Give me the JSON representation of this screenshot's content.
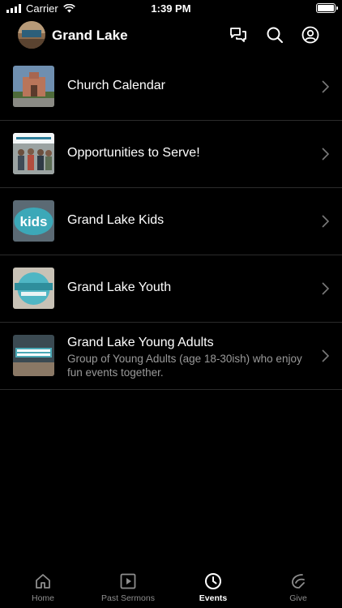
{
  "status_bar": {
    "carrier": "Carrier",
    "time": "1:39 PM"
  },
  "header": {
    "title": "Grand Lake",
    "avatar_logo_text": "GRAND LAKE",
    "icons": [
      "chat-icon",
      "search-icon",
      "account-icon"
    ]
  },
  "items": [
    {
      "title": "Church Calendar",
      "description": ""
    },
    {
      "title": "Opportunities to Serve!",
      "description": "",
      "thumb_text": "OPPORTUNITIES TO SERVE"
    },
    {
      "title": "Grand Lake Kids",
      "description": "",
      "thumb_text": "kids"
    },
    {
      "title": "Grand Lake Youth",
      "description": "",
      "thumb_text": "GRAND LAKE YOUTH"
    },
    {
      "title": "Grand Lake Young Adults",
      "description": "Group of Young Adults (age 18-30ish) who enjoy fun events together.",
      "thumb_text": "YOUNG ADULTS"
    }
  ],
  "tabs": [
    {
      "label": "Home",
      "icon": "home-icon",
      "active": false
    },
    {
      "label": "Past Sermons",
      "icon": "play-icon",
      "active": false
    },
    {
      "label": "Events",
      "icon": "clock-icon",
      "active": true
    },
    {
      "label": "Give",
      "icon": "give-icon",
      "active": false
    }
  ]
}
